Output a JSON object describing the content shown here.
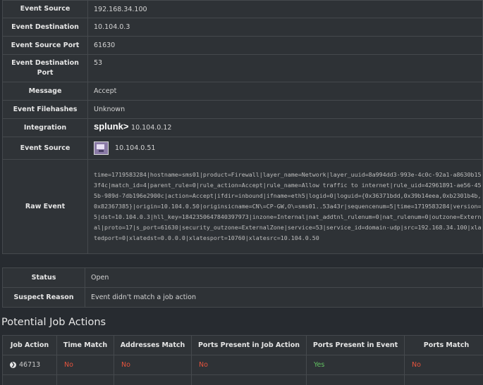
{
  "details": {
    "event_source_label": "Event Source",
    "event_source_value": "192.168.34.100",
    "event_destination_label": "Event Destination",
    "event_destination_value": "10.104.0.3",
    "event_source_port_label": "Event Source Port",
    "event_source_port_value": "61630",
    "event_destination_port_label": "Event Destination Port",
    "event_destination_port_value": "53",
    "message_label": "Message",
    "message_value": "Accept",
    "event_filehashes_label": "Event Filehashes",
    "event_filehashes_value": "Unknown",
    "integration_label": "Integration",
    "integration_logo_text": "splunk>",
    "integration_value": "10.104.0.12",
    "event_source2_label": "Event Source",
    "event_source2_icon": "computer-monitor-icon",
    "event_source2_value": "10.104.0.51",
    "raw_event_label": "Raw Event",
    "raw_event_value": "time=1719583284|hostname=sms01|product=Firewall|layer_name=Network|layer_uuid=8a994dd3-993e-4c0c-92a1-a8630b153f4c|match_id=4|parent_rule=0|rule_action=Accept|rule_name=Allow traffic to internet|rule_uid=42961891-ae56-455b-989d-7db196e2900c|action=Accept|ifdir=inbound|ifname=eth5|logid=0|loguid={0x36371bdd,0x39b14eea,0xb2301b4b,0x82367385}|origin=10.104.0.50|originsicname=CN\\=CP-GW,O\\=sms01..53a43r|sequencenum=5|time=1719583284|version=5|dst=10.104.0.3|hll_key=1842350647840397973|inzone=Internal|nat_addtnl_rulenum=0|nat_rulenum=0|outzone=External|proto=17|s_port=61630|security_outzone=ExternalZone|service=53|service_id=domain-udp|src=192.168.34.100|xlatedport=0|xlatedst=0.0.0.0|xlatesport=10760|xlatesrc=10.104.0.50"
  },
  "status": {
    "status_label": "Status",
    "status_value": "Open",
    "suspect_reason_label": "Suspect Reason",
    "suspect_reason_value": "Event didn't match a job action"
  },
  "jobs_section": {
    "title": "Potential Job Actions",
    "columns": [
      "Job Action",
      "Time Match",
      "Addresses Match",
      "Ports Present in Job Action",
      "Ports Present in Event",
      "Ports Match"
    ],
    "rows": [
      {
        "expand_icon": "chevron-right-circle-icon",
        "job_action": "46713",
        "time_match": "No",
        "addresses_match": "No",
        "ports_in_job_action": "No",
        "ports_in_event": "Yes",
        "ports_match": "No"
      }
    ]
  },
  "colors": {
    "background": "#272b30",
    "border": "#45494d",
    "no": "#e5533d",
    "yes": "#62c462"
  }
}
